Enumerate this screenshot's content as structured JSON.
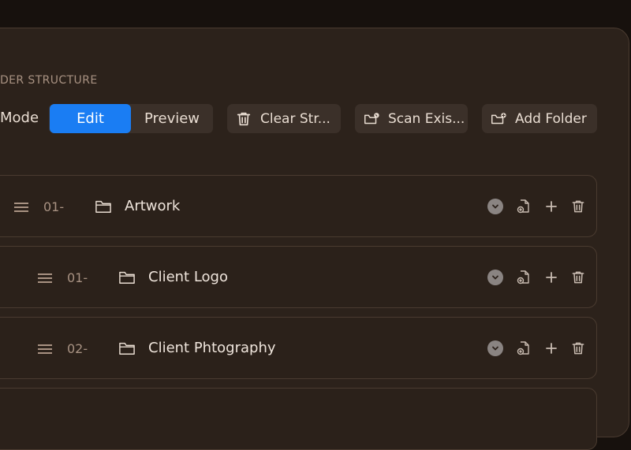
{
  "section": {
    "title": "DER STRUCTURE"
  },
  "mode": {
    "label": "Mode",
    "options": [
      {
        "label": "Edit",
        "selected": true
      },
      {
        "label": "Preview",
        "selected": false
      }
    ]
  },
  "toolbar": {
    "clear_label": "Clear Str...",
    "scan_label": "Scan Exis...",
    "add_folder_label": "Add Folder"
  },
  "colors": {
    "accent": "#1a7df3",
    "panel": "#2c221b",
    "background": "#17110d"
  },
  "folders": [
    {
      "number": "01-",
      "name": "Artwork"
    },
    {
      "number": "01-",
      "name": "Client Logo"
    },
    {
      "number": "02-",
      "name": "Client Phtography"
    }
  ]
}
